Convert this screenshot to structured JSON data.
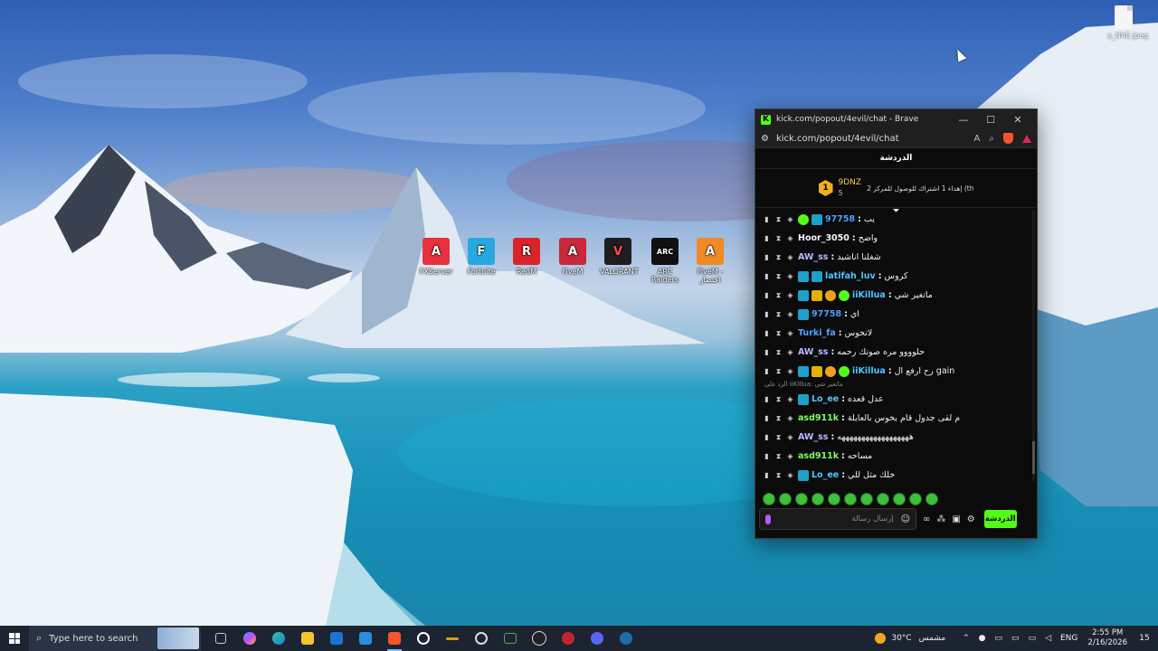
{
  "desktop": {
    "icons": [
      {
        "label": "FXServer",
        "glyph": "A",
        "color": "#e8313f"
      },
      {
        "label": "Fortnite",
        "glyph": "F",
        "color": "#29a8e0"
      },
      {
        "label": "RedM",
        "glyph": "R",
        "color": "#d9252a"
      },
      {
        "label": "FiveM",
        "glyph": "A",
        "color": "#c9283a"
      },
      {
        "label": "VALORANT",
        "glyph": "V",
        "color": "#1e1e1e"
      },
      {
        "label": "ARC Raiders",
        "glyph": "ARC",
        "color": "#111111"
      },
      {
        "label": "FiveM - اختصار",
        "glyph": "A",
        "color": "#f08a24"
      }
    ],
    "file_icon": {
      "label": "a_NVE.jpeg"
    }
  },
  "browser": {
    "title": "kick.com/popout/4evil/chat - Brave",
    "url": "kick.com/popout/4evil/chat",
    "window_controls": [
      "—",
      "☐",
      "✕"
    ]
  },
  "chat": {
    "header": "الدردشة",
    "pinned": {
      "rank": "1",
      "username": "9DNZ",
      "count": "5",
      "gift_text": "إهداء 1 اشتراك للوصول للمركز 2 (th"
    },
    "collapse_icon": "⏷",
    "messages": [
      {
        "badges": [
          "verified",
          "og"
        ],
        "user": "97758",
        "user_color": "#4f9fff",
        "text": "يب"
      },
      {
        "badges": [],
        "user": "Hoor_3050",
        "user_color": "#f5f5f5",
        "text": "واضح"
      },
      {
        "badges": [],
        "user": "AW_ss",
        "user_color": "#b7b8ff",
        "text": "شغلنا اناشيد"
      },
      {
        "badges": [
          "vip",
          "og"
        ],
        "user": "latifah_luv",
        "user_color": "#4fc8ff",
        "text": "كروس"
      },
      {
        "badges": [
          "vip",
          "crown",
          "rank",
          "verified"
        ],
        "user": "iiKillua",
        "user_color": "#4fc8ff",
        "text": "ماتغير شي"
      },
      {
        "badges": [
          "og"
        ],
        "user": "97758",
        "user_color": "#4f9fff",
        "text": "اي"
      },
      {
        "badges": [],
        "user": "Turki_fa",
        "user_color": "#4fa3ff",
        "text": "لاتخوس"
      },
      {
        "badges": [],
        "user": "AW_ss",
        "user_color": "#b7b8ff",
        "text": "حلوووو مره صوتك رحمه"
      },
      {
        "badges": [
          "vip",
          "crown",
          "rank",
          "verified"
        ],
        "user": "iiKillua",
        "user_color": "#4fc8ff",
        "text": "رح ارفع ال gain"
      },
      {
        "badges": [
          "og"
        ],
        "user": "Lo_ee",
        "user_color": "#4fc8ff",
        "text": "عدل قعده",
        "reply": "الرد على iiKillua: ماتغير شي"
      },
      {
        "badges": [],
        "user": "asd911k",
        "user_color": "#7dff5c",
        "text": "م لقى جدول قام يخوس بالعايلة"
      },
      {
        "badges": [],
        "user": "AW_ss",
        "user_color": "#b7b8ff",
        "text": "ههههههههههههههههههه"
      },
      {
        "badges": [],
        "user": "asd911k",
        "user_color": "#7dff5c",
        "text": "مساحه"
      },
      {
        "badges": [
          "og"
        ],
        "user": "Lo_ee",
        "user_color": "#4fc8ff",
        "text": "خلك مثل للي"
      }
    ],
    "input_placeholder": "إرسال رسالة",
    "send_label": "الدردشة"
  },
  "taskbar": {
    "search_placeholder": "Type here to search",
    "weather_temp": "30°C",
    "weather_condition": "مشمس",
    "language": "ENG",
    "time": "2:55 PM",
    "date": "2/16/2026",
    "notification_count": "15"
  }
}
